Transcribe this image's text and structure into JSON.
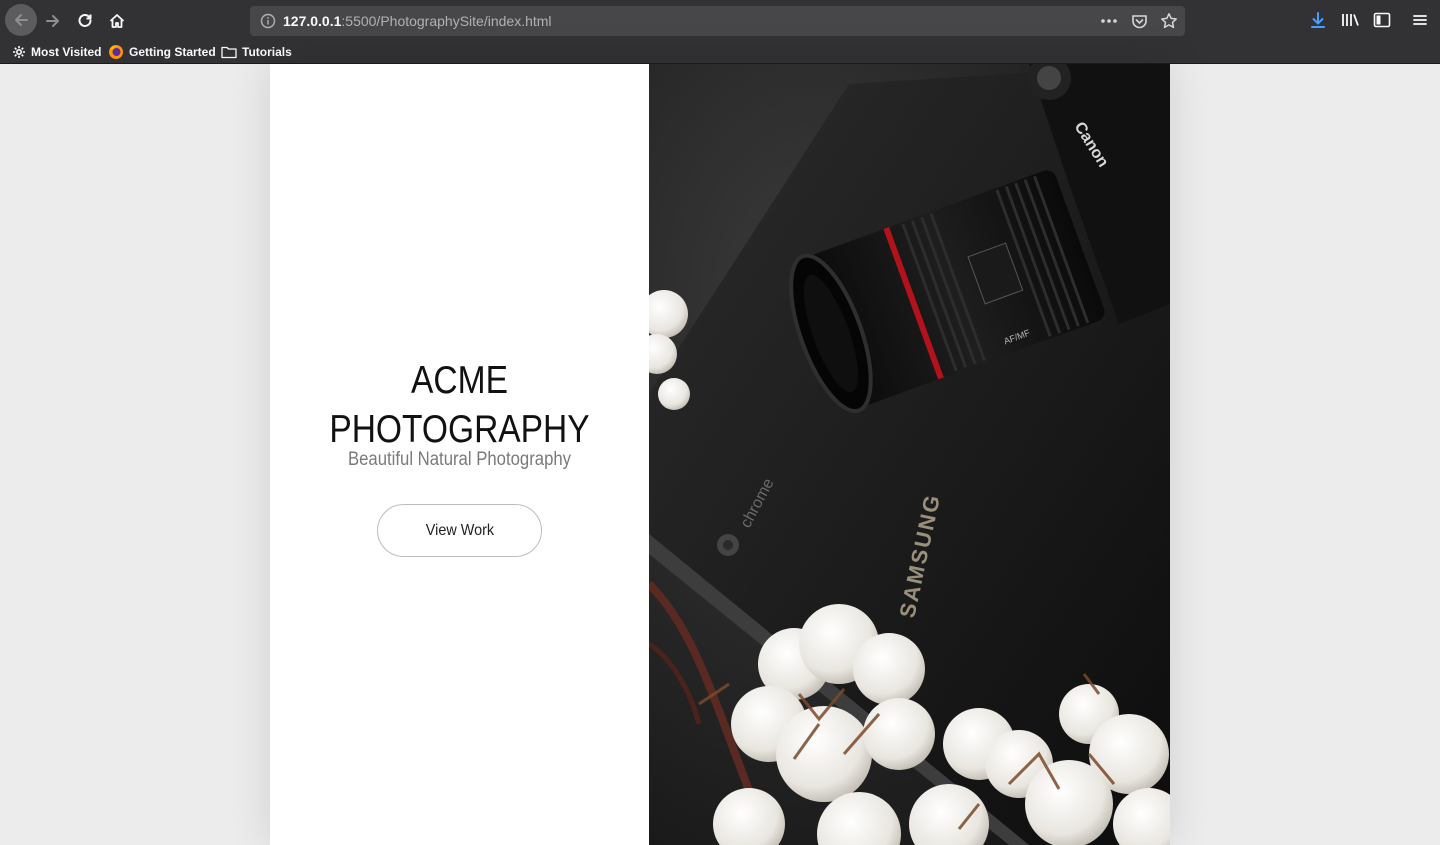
{
  "browser": {
    "url_host": "127.0.0.1",
    "url_rest": ":5500/PhotographySite/index.html",
    "bookmarks": [
      {
        "label": "Most Visited",
        "icon": "gear-icon"
      },
      {
        "label": "Getting Started",
        "icon": "firefox-icon"
      },
      {
        "label": "Tutorials",
        "icon": "folder-icon"
      }
    ]
  },
  "hero": {
    "title_line1": "ACME",
    "title_line2": "PHOTOGRAPHY",
    "subtitle": "Beautiful Natural Photography",
    "button_label": "View Work"
  },
  "photo": {
    "laptop_brand": "SAMSUNG",
    "laptop_os": "chrome",
    "camera_brand": "Canon",
    "lens_marking": "AF/MF"
  },
  "colors": {
    "chrome_bg": "#323234",
    "urlbar_bg": "#474749",
    "page_bg": "#ececec",
    "accent_download": "#45a1ff"
  }
}
